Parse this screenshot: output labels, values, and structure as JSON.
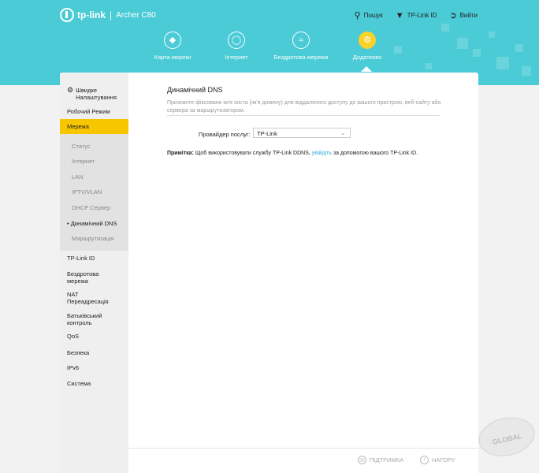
{
  "header": {
    "brand": "tp-link",
    "separator": "|",
    "model": "Archer C80",
    "links": [
      {
        "label": "Пошук",
        "icon": "search-icon"
      },
      {
        "label": "TP-Link ID",
        "icon": "cloud-user-icon"
      },
      {
        "label": "Вийти",
        "icon": "logout-icon"
      }
    ]
  },
  "nav": [
    {
      "label": "Карта мережі",
      "icon": "network-map-icon"
    },
    {
      "label": "Інтернет",
      "icon": "globe-icon"
    },
    {
      "label": "Бездротова мережа",
      "icon": "wifi-icon"
    },
    {
      "label": "Додатково",
      "icon": "gear-icon",
      "active": true
    }
  ],
  "sidebar": {
    "items": [
      {
        "label": "Швидке Налаштування",
        "icon": "gear-icon"
      },
      {
        "label": "Робочий Режим"
      },
      {
        "label": "Мережа",
        "active": true
      },
      {
        "label": "TP-Link ID"
      },
      {
        "label": "Бездротова мережа"
      },
      {
        "label": "NAT Переадресація"
      },
      {
        "label": "Батьківський контроль"
      },
      {
        "label": "QoS"
      },
      {
        "label": "Безпека"
      },
      {
        "label": "IPv6"
      },
      {
        "label": "Система"
      }
    ],
    "subitems": [
      {
        "label": "Статус"
      },
      {
        "label": "Інтернет"
      },
      {
        "label": "LAN"
      },
      {
        "label": "IPTV/VLAN"
      },
      {
        "label": "DHCP Сервер"
      },
      {
        "label": "Динамічний DNS",
        "current": true
      },
      {
        "label": "Маршрутизація"
      }
    ]
  },
  "main": {
    "title": "Динамічний DNS",
    "description": "Призначте фіксоване ім'я хоста (ім'я домену) для віддаленого доступу до вашого пристрою, веб-сайту або сервера за маршрутизатором.",
    "provider_label": "Провайдер послуг:",
    "provider_value": "TP-Link",
    "note_label": "Примітка:",
    "note_text_1": "Щоб використовувати службу TP-Link DDNS,",
    "note_link": "увійдіть",
    "note_text_2": "за допомогою вашого TP-Link ID."
  },
  "footer": {
    "support": "ПІДТРИМКА",
    "top": "НАГОРУ"
  },
  "watermark": "GLOBAL",
  "colors": {
    "header": "#4acbd6",
    "active": "#f7c600",
    "link": "#2aaad0"
  }
}
